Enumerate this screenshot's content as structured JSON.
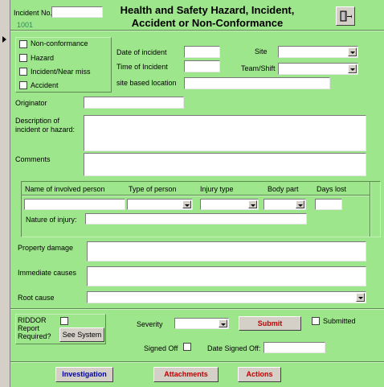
{
  "header": {
    "incident_no_label": "Incident No.",
    "incident_no_value": "",
    "incident_number": "1001",
    "title": "Health and Safety Hazard, Incident,\nAccident or Non-Conformance",
    "exit_icon": "exit-door-icon"
  },
  "categories": [
    {
      "label": "Non-conformance",
      "checked": false
    },
    {
      "label": "Hazard",
      "checked": false
    },
    {
      "label": "Incident/Near miss",
      "checked": false
    },
    {
      "label": "Accident",
      "checked": false
    }
  ],
  "fields": {
    "date_of_incident_label": "Date of incident",
    "date_of_incident_value": "",
    "time_of_incident_label": "Time of Incident",
    "time_of_incident_value": "",
    "site_label": "Site",
    "site_value": "",
    "team_shift_label": "Team/Shift",
    "team_shift_value": "",
    "site_location_label": "site based location",
    "site_location_value": "",
    "originator_label": "Originator",
    "originator_value": "",
    "description_label": "Description of incident or hazard:",
    "description_value": "",
    "comments_label": "Comments",
    "comments_value": ""
  },
  "involved": {
    "columns": [
      "Name of involved person",
      "Type of person",
      "Injury type",
      "Body part",
      "Days lost"
    ],
    "row": {
      "name": "",
      "type_of_person": "",
      "injury_type": "",
      "body_part": "",
      "days_lost": ""
    },
    "nature_label": "Nature of injury:",
    "nature_value": ""
  },
  "lower": {
    "property_damage_label": "Property damage",
    "property_damage_value": "",
    "immediate_causes_label": "Immediate causes",
    "immediate_causes_value": "",
    "root_cause_label": "Root cause",
    "root_cause_value": ""
  },
  "riddor": {
    "label": "RIDDOR Report Required?",
    "checked": false,
    "see_system_label": "See System"
  },
  "status": {
    "severity_label": "Severity",
    "severity_value": "",
    "submit_label": "Submit",
    "submitted_label": "Submitted",
    "submitted_checked": false,
    "signed_off_label": "Signed Off",
    "signed_off_checked": false,
    "date_signed_off_label": "Date Signed Off:",
    "date_signed_off_value": ""
  },
  "footer": {
    "investigation_label": "Investigation",
    "attachments_label": "Attachments",
    "actions_label": "Actions"
  },
  "colors": {
    "background": "#9ee68c",
    "accent_red": "#c00000",
    "accent_blue": "#0000a0",
    "number_green": "#2e8b57"
  }
}
